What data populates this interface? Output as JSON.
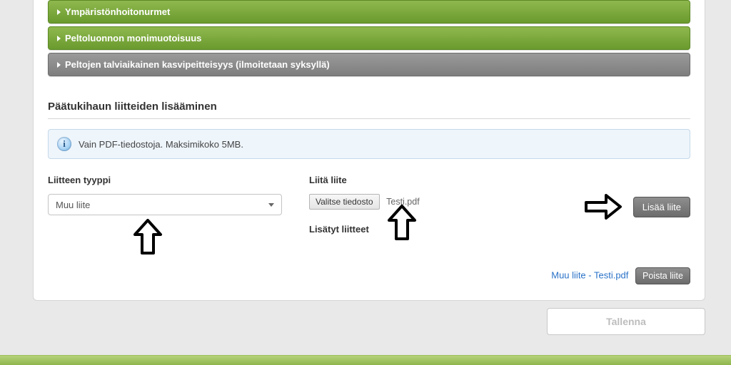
{
  "accordion": [
    {
      "label": "Ympäristönhoitonurmet",
      "style": "green"
    },
    {
      "label": "Peltoluonnon monimuotoisuus",
      "style": "green"
    },
    {
      "label": "Peltojen talviaikainen kasvipeitteisyys (ilmoitetaan syksyllä)",
      "style": "gray"
    }
  ],
  "attachments": {
    "section_title": "Päätukihaun liitteiden lisääminen",
    "info_text": "Vain PDF-tiedostoja. Maksimikoko 5MB.",
    "type_label": "Liitteen tyyppi",
    "type_selected": "Muu liite",
    "attach_label": "Liitä liite",
    "choose_file_label": "Valitse tiedosto",
    "chosen_file": "Testi.pdf",
    "add_button": "Lisää liite",
    "added_label": "Lisätyt liitteet",
    "added_entry_text": "Muu liite - Testi.pdf",
    "remove_button": "Poista liite"
  },
  "save_button": "Tallenna",
  "icons": {
    "info": "info-icon",
    "caret_right": "caret-right-icon",
    "caret_down": "caret-down-icon",
    "annotation_arrow_up": "arrow-up-icon",
    "annotation_arrow_right": "arrow-right-icon"
  }
}
